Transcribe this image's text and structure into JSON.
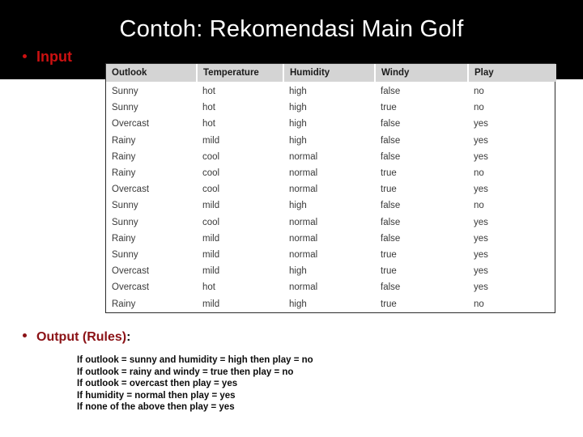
{
  "slide": {
    "title": "Contoh: Rekomendasi Main Golf",
    "title_color": "#ffffff",
    "header_background": "#000000",
    "body_background": "#ffffff"
  },
  "input_section": {
    "bullet_label": "Input",
    "bullet_color": "#cc1111"
  },
  "table": {
    "headers": [
      "Outlook",
      "Temperature",
      "Humidity",
      "Windy",
      "Play"
    ],
    "header_background": "#d4d4d4",
    "border_color": "#2b2b2b",
    "rows": [
      [
        "Sunny",
        "hot",
        "high",
        "false",
        "no"
      ],
      [
        "Sunny",
        "hot",
        "high",
        "true",
        "no"
      ],
      [
        "Overcast",
        "hot",
        "high",
        "false",
        "yes"
      ],
      [
        "Rainy",
        "mild",
        "high",
        "false",
        "yes"
      ],
      [
        "Rainy",
        "cool",
        "normal",
        "false",
        "yes"
      ],
      [
        "Rainy",
        "cool",
        "normal",
        "true",
        "no"
      ],
      [
        "Overcast",
        "cool",
        "normal",
        "true",
        "yes"
      ],
      [
        "Sunny",
        "mild",
        "high",
        "false",
        "no"
      ],
      [
        "Sunny",
        "cool",
        "normal",
        "false",
        "yes"
      ],
      [
        "Rainy",
        "mild",
        "normal",
        "false",
        "yes"
      ],
      [
        "Sunny",
        "mild",
        "normal",
        "true",
        "yes"
      ],
      [
        "Overcast",
        "mild",
        "high",
        "true",
        "yes"
      ],
      [
        "Overcast",
        "hot",
        "normal",
        "false",
        "yes"
      ],
      [
        "Rainy",
        "mild",
        "high",
        "true",
        "no"
      ]
    ]
  },
  "output_section": {
    "bullet_label": "Output (Rules)",
    "bullet_colon": ":",
    "bullet_color": "#8b1216",
    "rules": [
      "If outlook = sunny and humidity = high then play = no",
      "If outlook = rainy and windy = true then play = no",
      "If outlook = overcast then play = yes",
      "If humidity = normal then play = yes",
      "If none of the above then play = yes"
    ]
  }
}
